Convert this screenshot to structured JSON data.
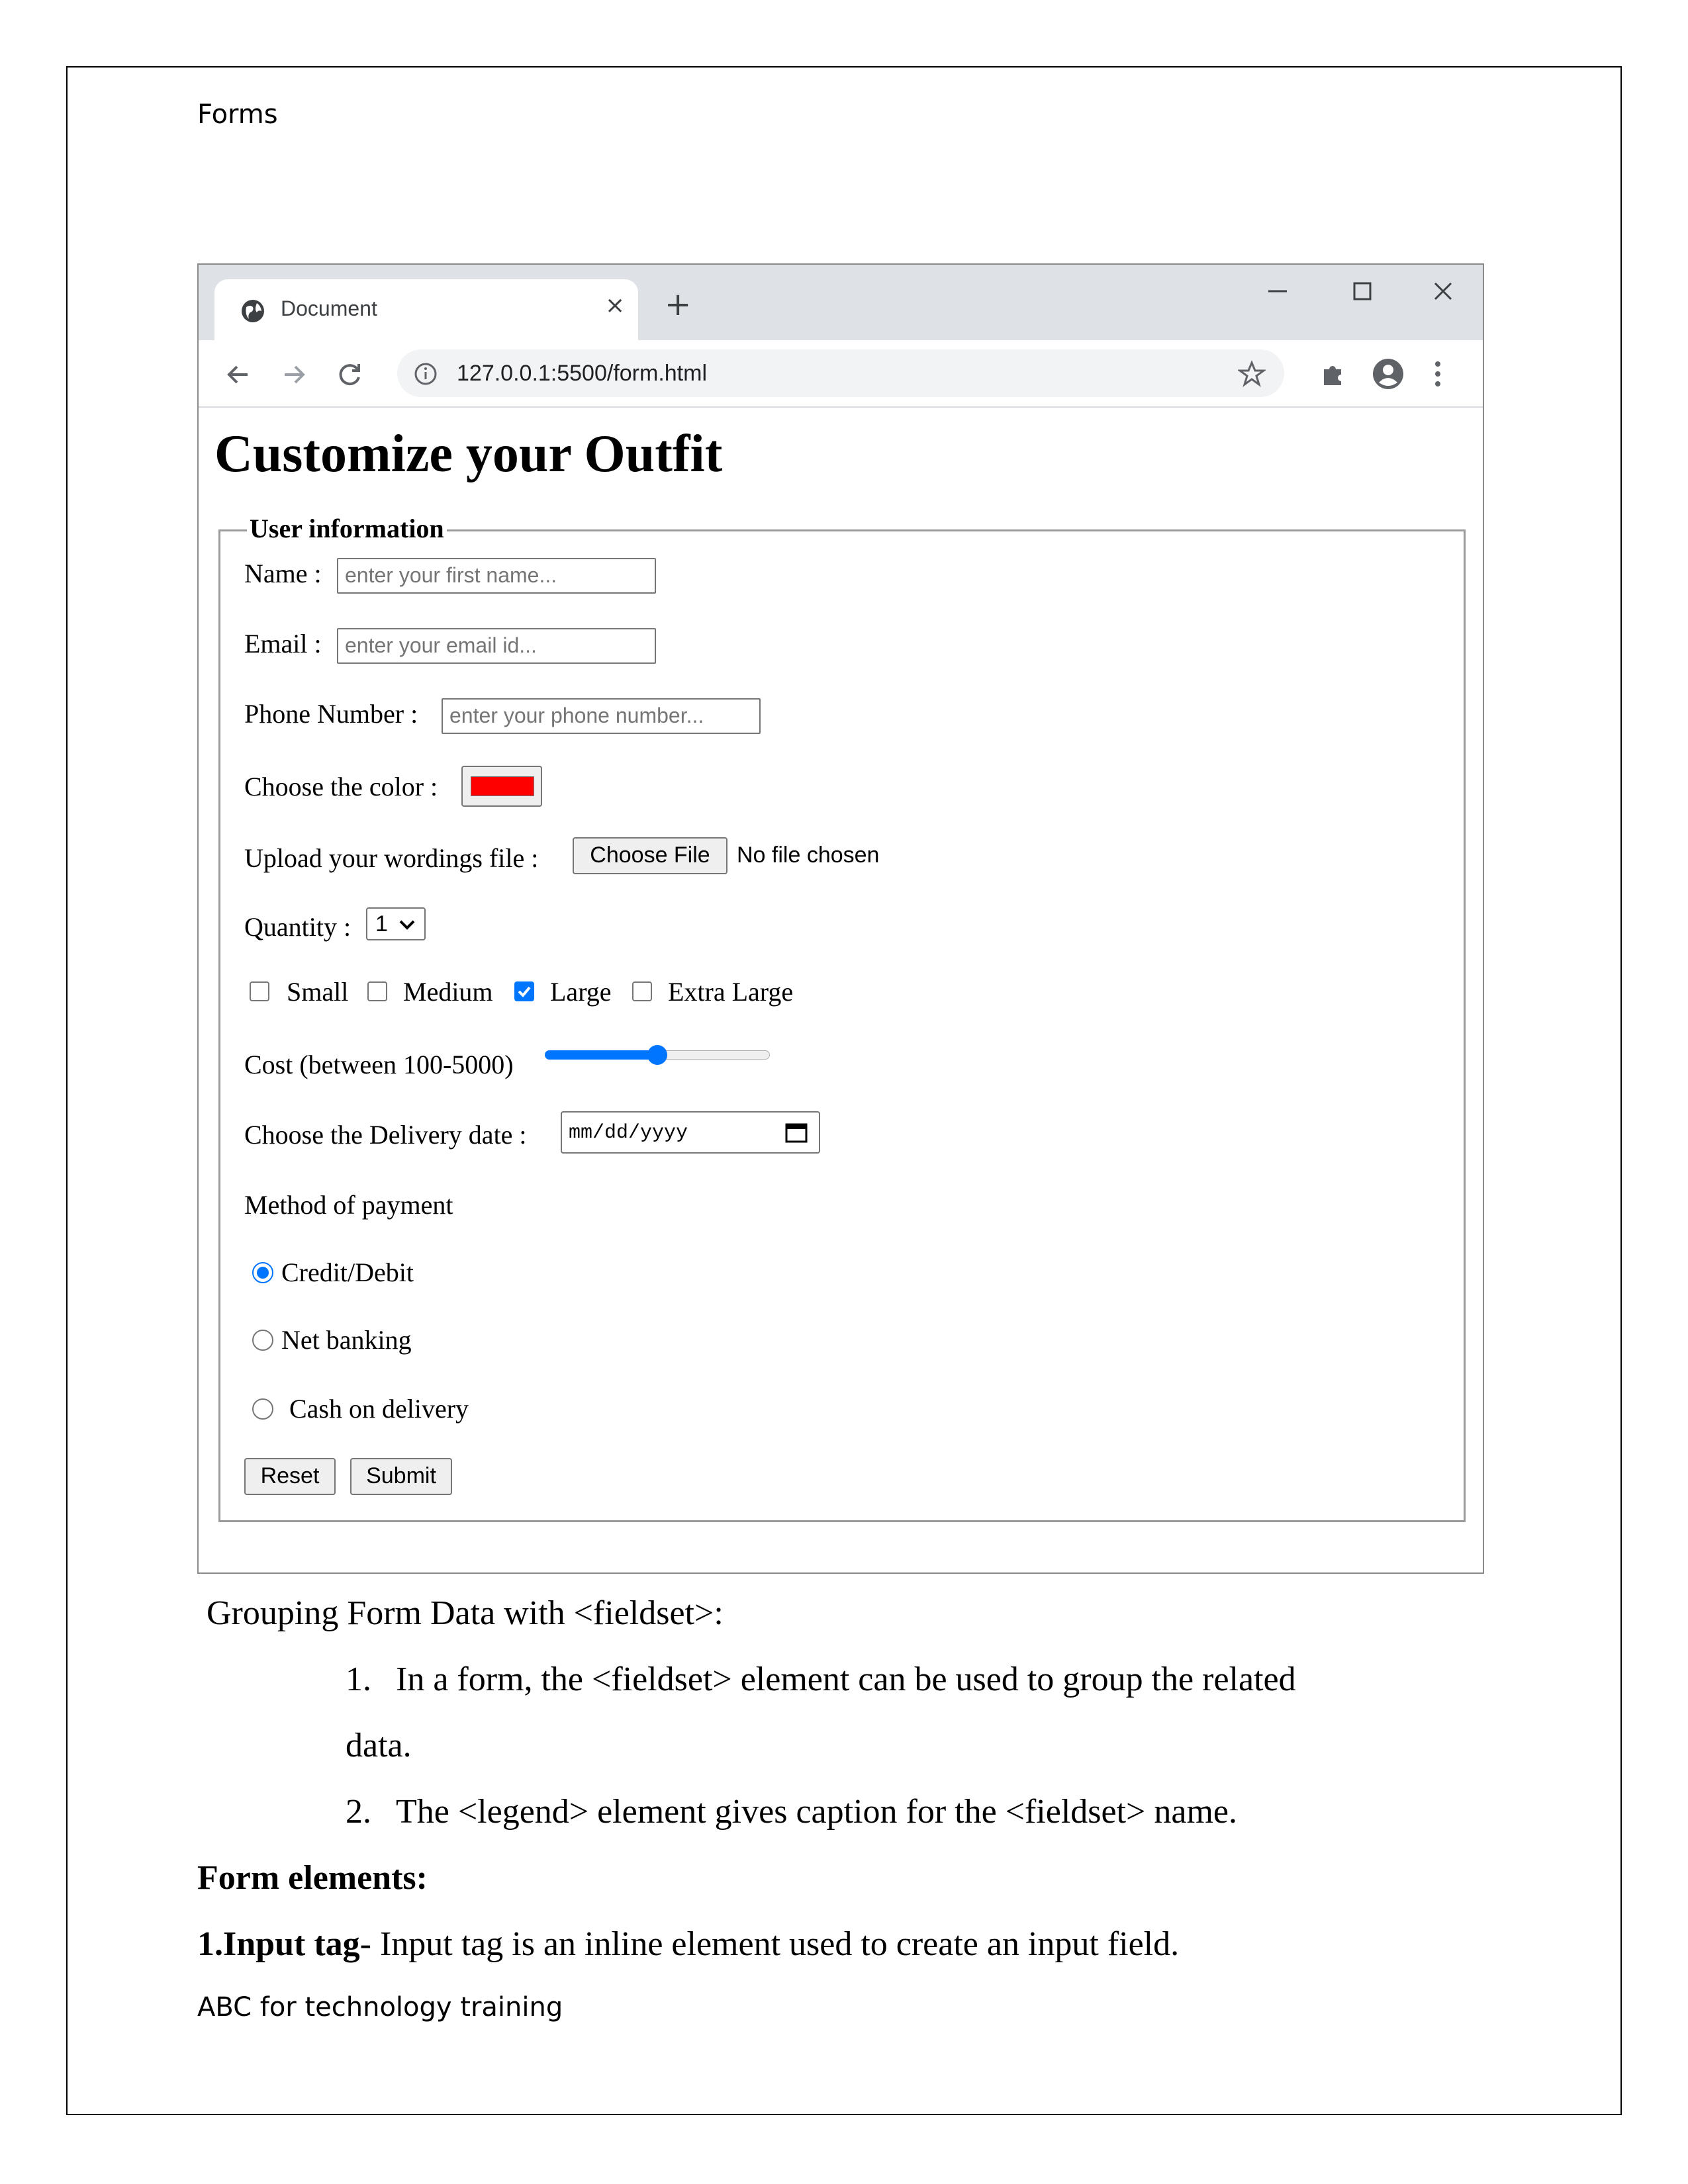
{
  "header": {
    "text": "Forms"
  },
  "footer": {
    "text": "ABC for technology training"
  },
  "browser": {
    "tab_title": "Document",
    "tab_close": "×",
    "new_tab": "+",
    "url": "127.0.0.1:5500/form.html"
  },
  "form": {
    "title": "Customize your Outfit",
    "legend": "User information",
    "name_label": "Name :",
    "name_placeholder": "enter your first name...",
    "email_label": "Email :",
    "email_placeholder": "enter your email id...",
    "phone_label": "Phone Number :",
    "phone_placeholder": "enter your phone number...",
    "color_label": "Choose the color :",
    "color_value": "#ff0000",
    "upload_label": "Upload your wordings file :",
    "choose_file_label": "Choose File",
    "no_file_text": "No file chosen",
    "quantity_label": "Quantity :",
    "quantity_value": "1",
    "sizes": [
      {
        "label": "Small",
        "checked": false
      },
      {
        "label": "Medium",
        "checked": false
      },
      {
        "label": "Large",
        "checked": true
      },
      {
        "label": "Extra Large",
        "checked": false
      }
    ],
    "cost_label": "Cost (between 100-5000)",
    "cost_slider_fraction": 0.5,
    "date_label": "Choose the Delivery date :",
    "date_placeholder": "mm/dd/yyyy",
    "payment_label": "Method of payment",
    "payment_options": [
      {
        "label": "Credit/Debit",
        "checked": true
      },
      {
        "label": "Net banking",
        "checked": false
      },
      {
        "label": "Cash on delivery",
        "checked": false
      }
    ],
    "reset_label": "Reset",
    "submit_label": "Submit"
  },
  "content": {
    "heading": "Grouping Form Data with <fieldset>:",
    "list": [
      {
        "num": "1.",
        "text": "In a form, the <fieldset> element can be used to group the related",
        "cont": "data."
      },
      {
        "num": "2.",
        "text": "The <legend> element gives caption for the <fieldset> name."
      }
    ],
    "section_title": "Form elements:",
    "input_tag_bold": "1.Input tag",
    "input_tag_text": "- Input tag is an inline element used to create an input field."
  },
  "colors": {
    "accent": "#0075ff",
    "tabbar": "#dee1e6",
    "color_swatch": "#ff0000"
  }
}
